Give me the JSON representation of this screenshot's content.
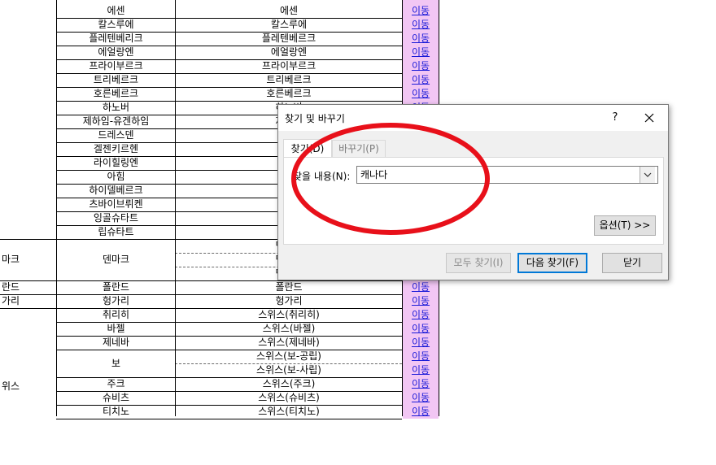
{
  "sheet": {
    "region_labels": [
      "마크",
      "란드",
      "가리",
      "위스"
    ],
    "rows": [
      {
        "b": "에센",
        "c": "에센",
        "link": "이동"
      },
      {
        "b": "칼스루에",
        "c": "칼스루에",
        "link": "이동"
      },
      {
        "b": "플레텐베리크",
        "c": "플레텐베르크",
        "link": "이동"
      },
      {
        "b": "에얼랑엔",
        "c": "에얼랑엔",
        "link": "이동"
      },
      {
        "b": "프라이부르크",
        "c": "프라이부르크",
        "link": "이동"
      },
      {
        "b": "트리베르크",
        "c": "트리베르크",
        "link": "이동"
      },
      {
        "b": "호른베르크",
        "c": "호른베르크",
        "link": "이동"
      },
      {
        "b": "하노버",
        "c": "하노버",
        "link": "이동"
      },
      {
        "b": "제하임-유겐하임",
        "c": "제하임",
        "link": "이동"
      },
      {
        "b": "드레스덴",
        "c": "드",
        "link": "이동"
      },
      {
        "b": "겔젠키르헨",
        "c": "겔젠",
        "link": "이동"
      },
      {
        "b": "라이힐링엔",
        "c": "라이",
        "link": "이동"
      },
      {
        "b": "아힘",
        "c": "",
        "link": "이동"
      },
      {
        "b": "하이델베르크",
        "c": "하이",
        "link": "이동"
      },
      {
        "b": "츠바이브뤼켄",
        "c": "츠바",
        "link": "이동"
      },
      {
        "b": "잉골슈타트",
        "c": "잉골",
        "link": "이동"
      },
      {
        "b": "립슈타트",
        "c": "립",
        "link": "이동"
      },
      {
        "b": "",
        "c": "덴마크",
        "link": "이동"
      },
      {
        "b": "덴마크",
        "c": "덴마크",
        "link": "이동"
      },
      {
        "b": "",
        "c": "덴마크",
        "link": "이동"
      },
      {
        "b": "폴란드",
        "c": "폴란드",
        "link": "이동"
      },
      {
        "b": "헝가리",
        "c": "헝가리",
        "link": "이동"
      },
      {
        "b": "취리히",
        "c": "스위스(취리히)",
        "link": "이동"
      },
      {
        "b": "바젤",
        "c": "스위스(바젤)",
        "link": "이동"
      },
      {
        "b": "제네바",
        "c": "스위스(제네바)",
        "link": "이동"
      },
      {
        "b": "",
        "c": "스위스(보-공립)",
        "link": "이동"
      },
      {
        "b": "보",
        "c": "스위스(보-사립)",
        "link": "이동"
      },
      {
        "b": "주크",
        "c": "스위스(주크)",
        "link": "이동"
      },
      {
        "b": "슈비츠",
        "c": "스위스(슈비츠)",
        "link": "이동"
      },
      {
        "b": "티치노",
        "c": "스위스(티치노)",
        "link": "이동"
      }
    ]
  },
  "dialog": {
    "title": "찾기 및 바꾸기",
    "help": "?",
    "tabs": {
      "find": "찾기(D)",
      "replace": "바꾸기(P)"
    },
    "find_label": "찾을 내용(N):",
    "find_value": "캐나다",
    "buttons": {
      "options": "옵션(T) >>",
      "find_all": "모두 찾기(I)",
      "find_next": "다음 찾기(F)",
      "close": "닫기"
    }
  },
  "annotation": {
    "color": "#e8101a"
  }
}
